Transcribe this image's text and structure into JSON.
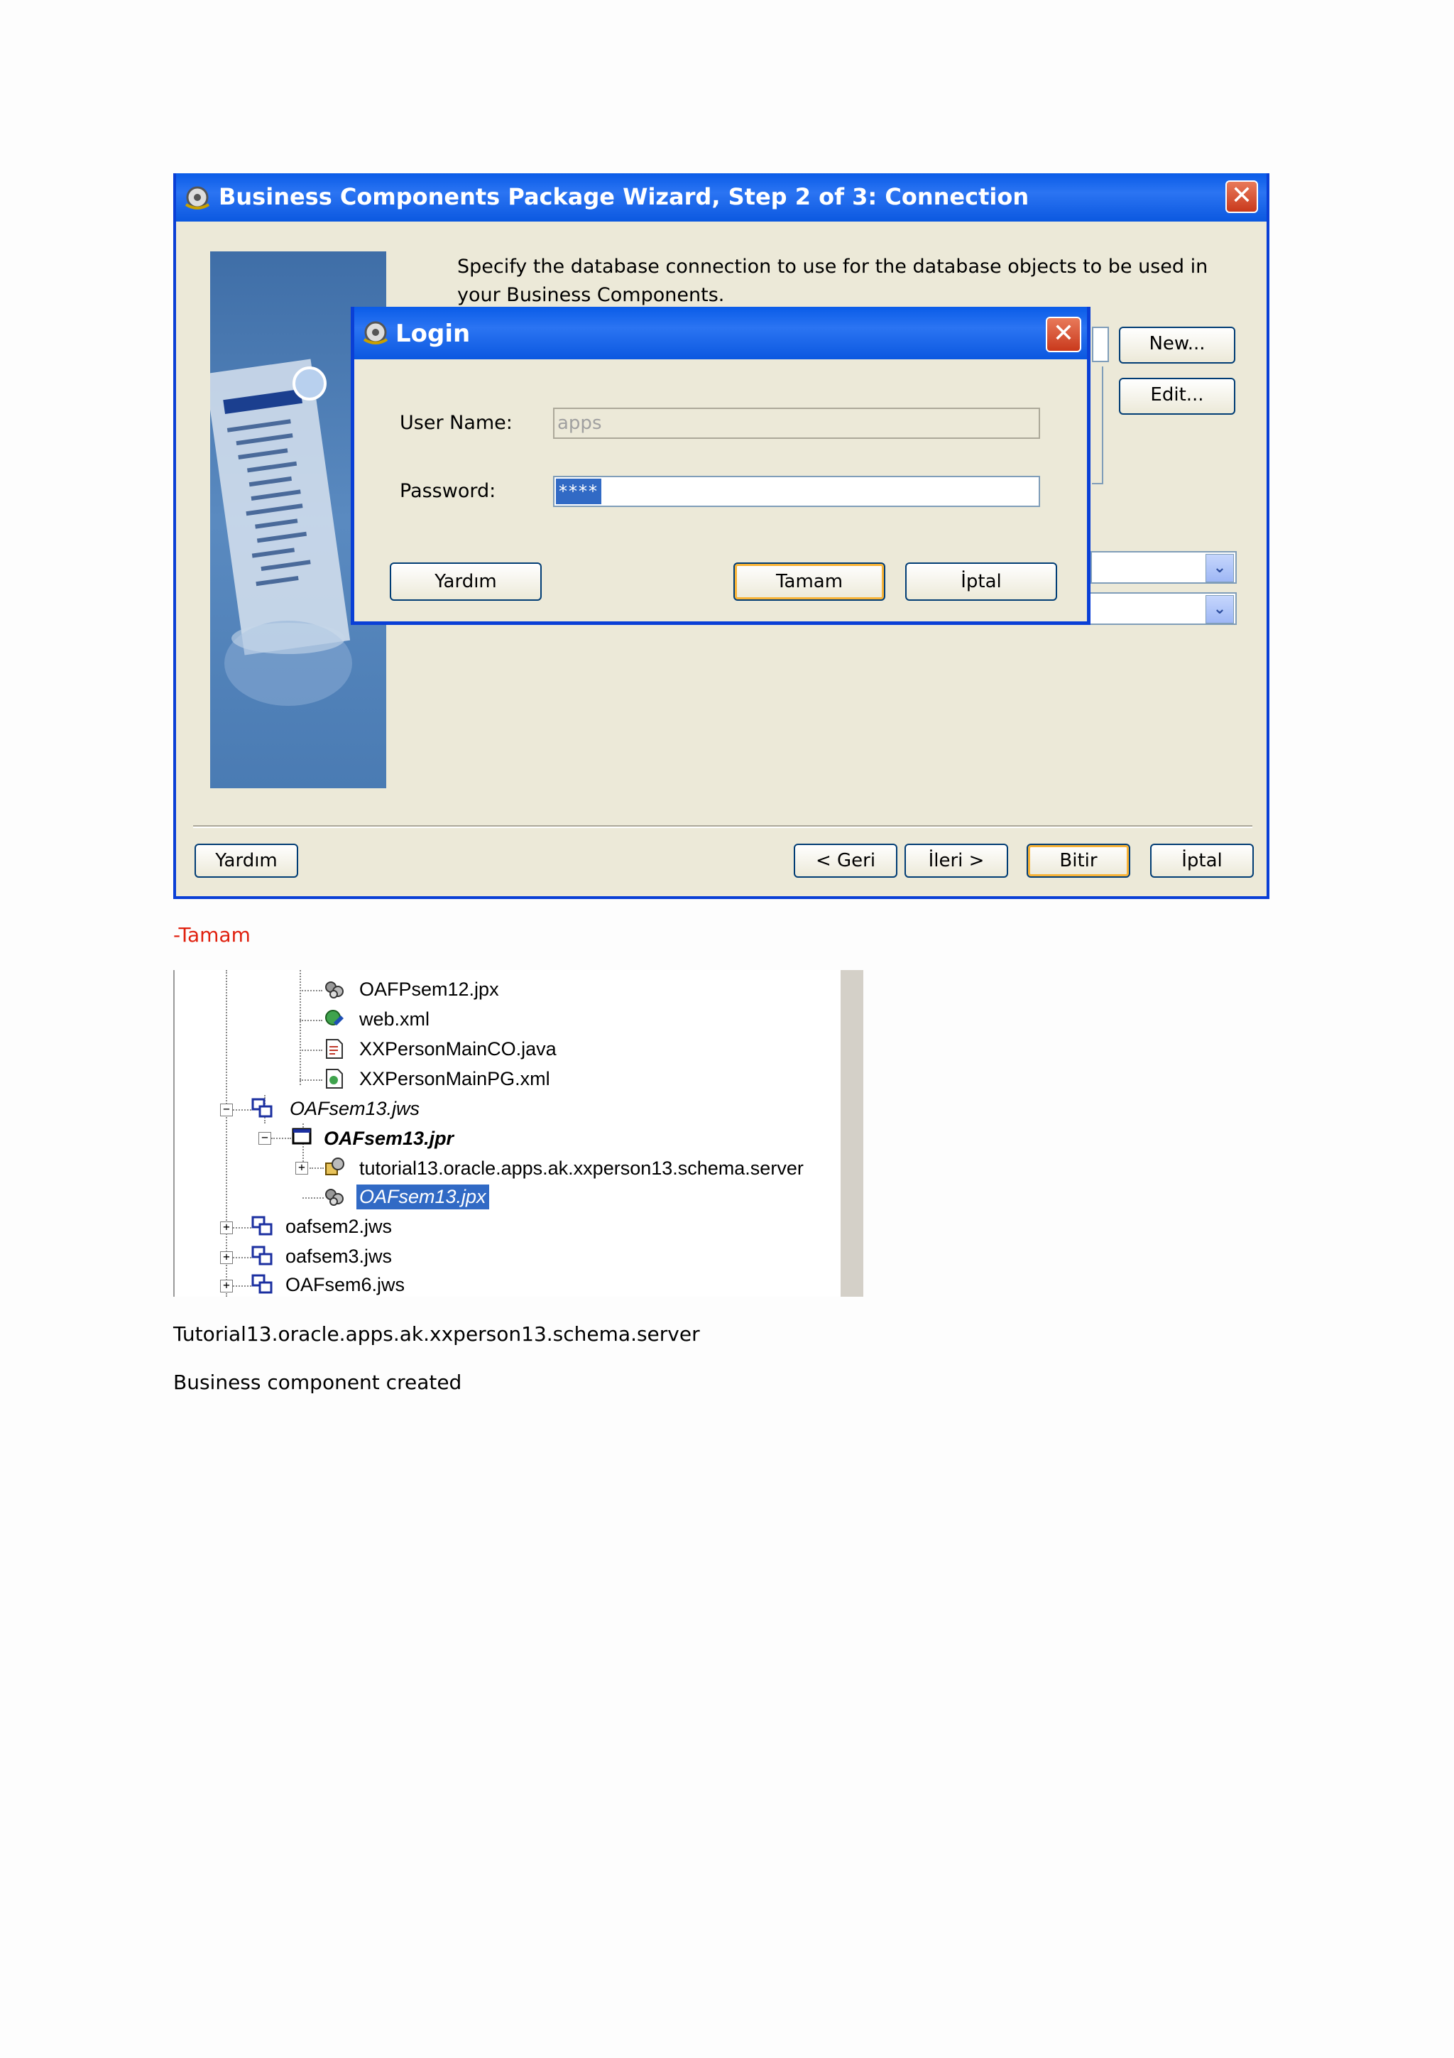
{
  "wizard": {
    "title": "Business Components Package Wizard, Step 2 of 3: Connection",
    "instruction": "Specify the database connection to use for the database objects to be used in your Business Components.",
    "new_button": "New...",
    "edit_button": "Edit...",
    "buttons": {
      "help": "Yardım",
      "back": "< Geri",
      "next": "İleri >",
      "finish": "Bitir",
      "cancel": "İptal"
    }
  },
  "login": {
    "title": "Login",
    "username_label": "User Name:",
    "username_value": "apps",
    "password_label": "Password:",
    "password_value": "****",
    "buttons": {
      "help": "Yardım",
      "ok": "Tamam",
      "cancel": "İptal"
    }
  },
  "note_ok": "-Tamam",
  "tree": {
    "items": [
      {
        "label": "OAFPsem12.jpx",
        "icon": "gear-package-icon"
      },
      {
        "label": "web.xml",
        "icon": "web-xml-icon"
      },
      {
        "label": "XXPersonMainCO.java",
        "icon": "java-file-icon"
      },
      {
        "label": "XXPersonMainPG.xml",
        "icon": "xml-file-icon"
      },
      {
        "label": "OAFsem13.jws",
        "icon": "workspace-icon"
      },
      {
        "label": "OAFsem13.jpr",
        "icon": "project-icon"
      },
      {
        "label": "tutorial13.oracle.apps.ak.xxperson13.schema.server",
        "icon": "package-icon"
      },
      {
        "label": "OAFsem13.jpx",
        "icon": "gear-package-icon"
      },
      {
        "label": "oafsem2.jws",
        "icon": "workspace-icon"
      },
      {
        "label": "oafsem3.jws",
        "icon": "workspace-icon"
      },
      {
        "label": "OAFsem6.jws",
        "icon": "workspace-icon"
      }
    ]
  },
  "caption_package": "Tutorial13.oracle.apps.ak.xxperson13.schema.server",
  "caption_created": "Business component created",
  "colors": {
    "title_bar": "#0b58e0",
    "dialog_bg": "#ece9d8",
    "note": "#e0200e",
    "selection": "#316ac5"
  }
}
